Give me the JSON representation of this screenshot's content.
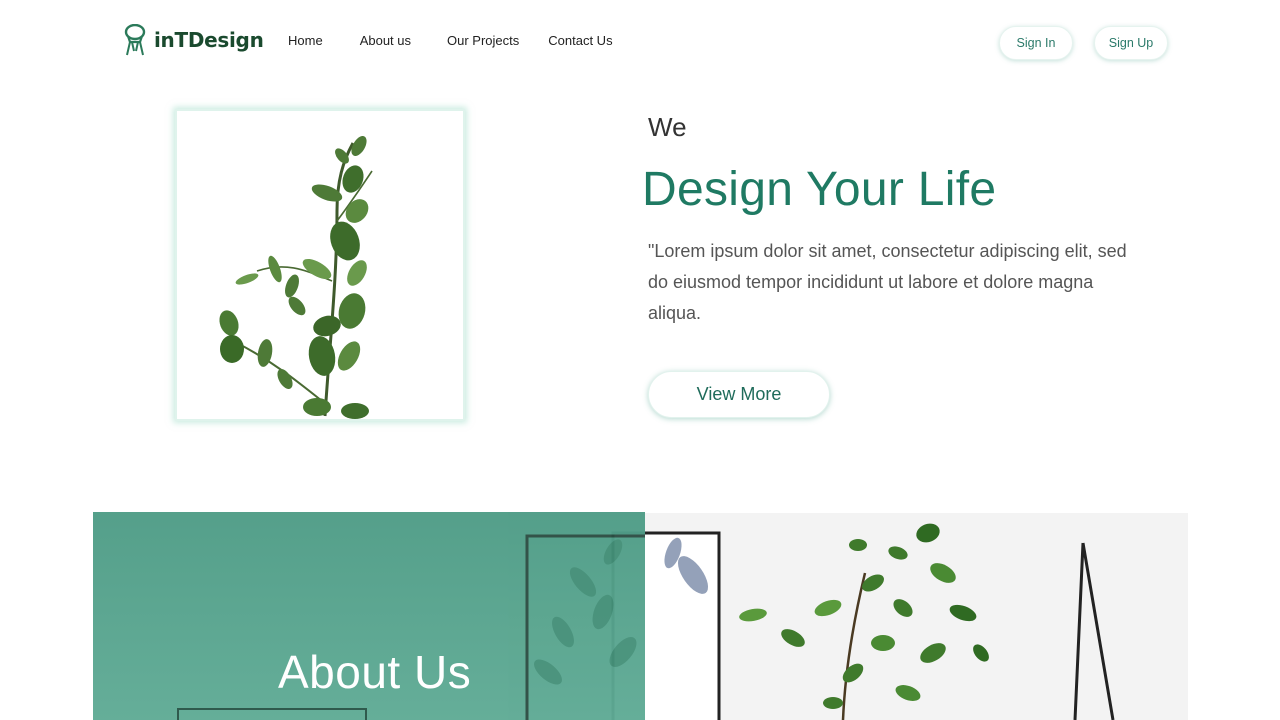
{
  "brand": {
    "name": "inTDesign",
    "logo_icon": "chair-icon",
    "color": "#1a4a2e"
  },
  "nav": {
    "links": [
      "Home",
      "About us",
      "Our Projects",
      "Contact Us"
    ],
    "sign_in": "Sign In",
    "sign_up": "Sign Up"
  },
  "hero": {
    "image": "eucalyptus-branch-photo",
    "kicker": "We",
    "headline": "Design Your Life",
    "body": "\"Lorem ipsum dolor sit amet, consectetur adipiscing elit, sed do eiusmod tempor incididunt ut labore et dolore magna aliqua.",
    "cta": "View More"
  },
  "about": {
    "title": "About Us",
    "image": "potted-plant-interior-photo"
  },
  "colors": {
    "accent": "#1f7a63",
    "overlay": "#4e9c86",
    "button_text": "#2b7a6a"
  }
}
